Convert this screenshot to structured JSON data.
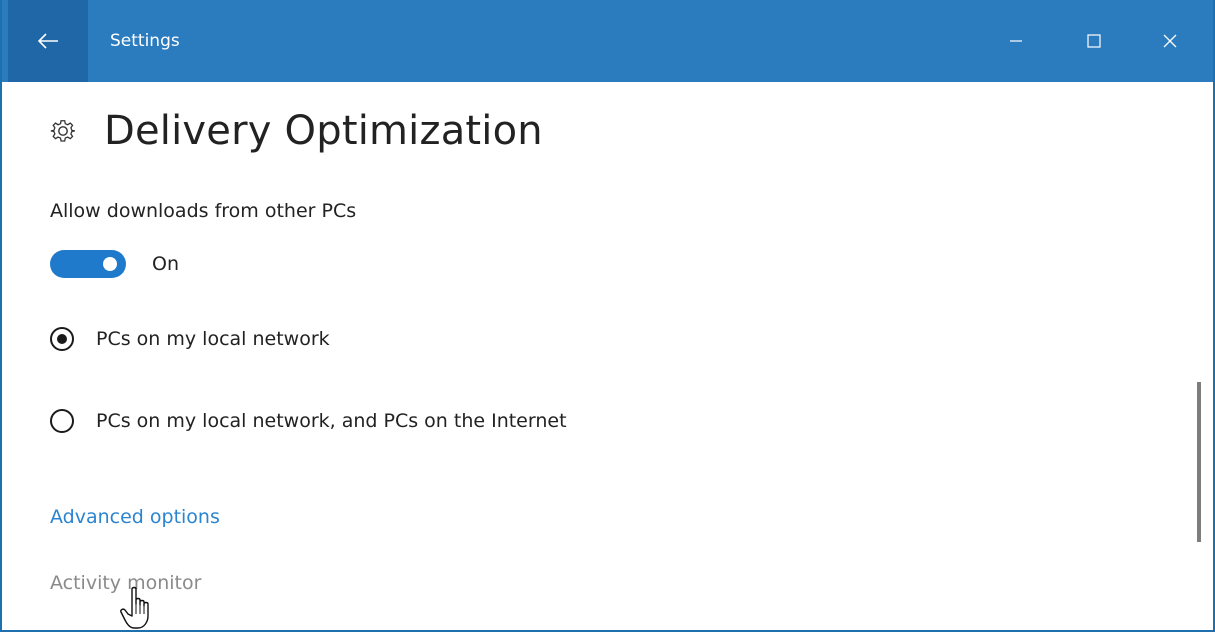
{
  "window": {
    "title": "Settings",
    "back_icon": "back-arrow-icon",
    "minimize_icon": "minimize-icon",
    "maximize_icon": "maximize-icon",
    "close_icon": "close-icon",
    "titlebar_color": "#2b7bbf",
    "accent_color": "#1f7acc"
  },
  "page": {
    "icon": "gear-icon",
    "title": "Delivery Optimization"
  },
  "setting": {
    "label": "Allow downloads from other PCs",
    "toggle_state": "On",
    "toggle_on": true
  },
  "options": [
    {
      "label": "PCs on my local network",
      "selected": true
    },
    {
      "label": "PCs on my local network, and PCs on the Internet",
      "selected": false
    }
  ],
  "links": {
    "advanced": "Advanced options",
    "activity": "Activity monitor",
    "link_color": "#2b84d0"
  }
}
